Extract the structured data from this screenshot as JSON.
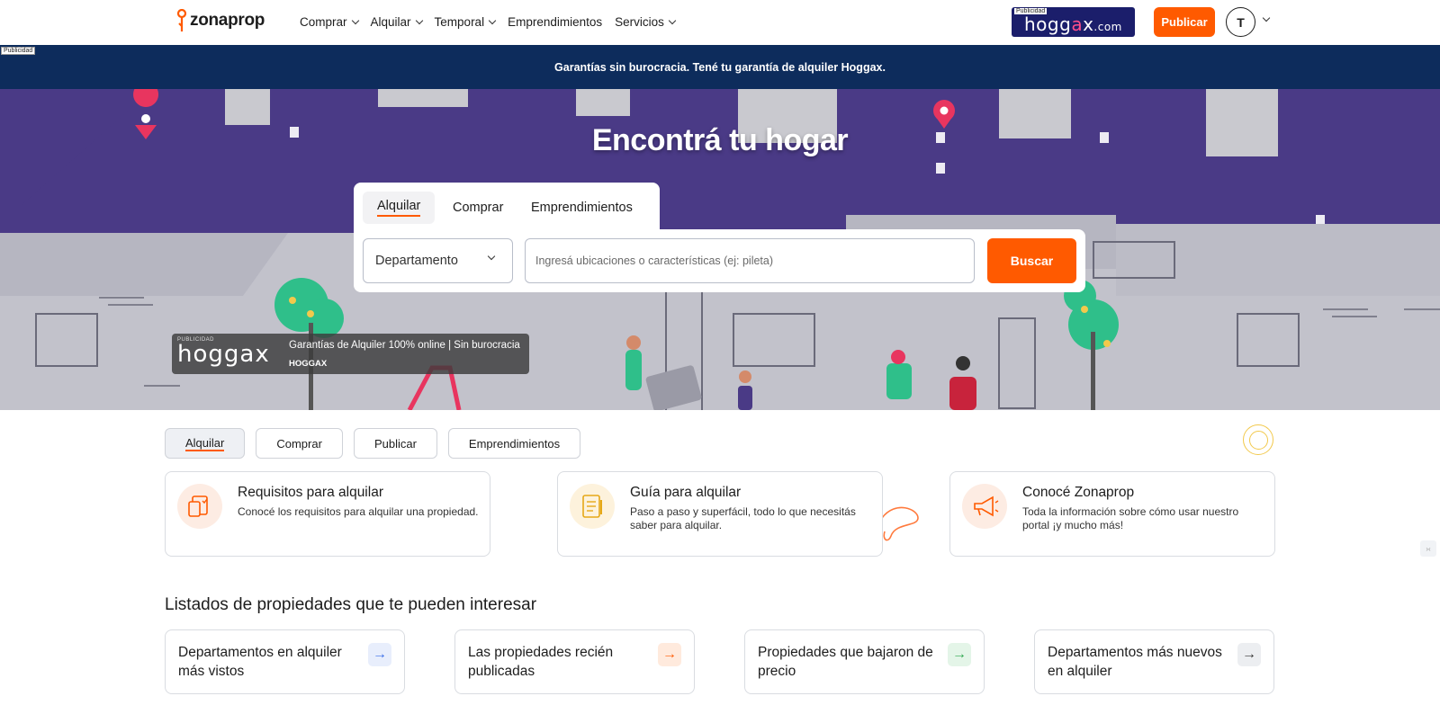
{
  "header": {
    "logo_text": "zonaprop",
    "nav": [
      {
        "label": "Comprar",
        "has_menu": true
      },
      {
        "label": "Alquilar",
        "has_menu": true
      },
      {
        "label": "Temporal",
        "has_menu": true
      },
      {
        "label": "Emprendimientos",
        "has_menu": false
      },
      {
        "label": "Servicios",
        "has_menu": true
      }
    ],
    "ad": {
      "tag": "Publicidad",
      "brand_main": "hogg",
      "brand_x": "a",
      "brand_end": "x",
      "brand_domain": ".com"
    },
    "publish_label": "Publicar",
    "avatar_initial": "T"
  },
  "banner": {
    "tag": "Publicidad",
    "text": "Garantías sin burocracia.  Tené tu garantía de alquiler Hoggax."
  },
  "hero": {
    "title": "Encontrá tu hogar",
    "tabs": [
      "Alquilar",
      "Comprar",
      "Emprendimientos"
    ],
    "active_tab": "Alquilar",
    "property_type": "Departamento",
    "search_placeholder": "Ingresá ubicaciones o características (ej: pileta)",
    "search_button": "Buscar",
    "ad": {
      "tag": "PUBLICIDAD",
      "brand": "hoggax",
      "title": "Garantías de Alquiler 100% online | Sin burocracia",
      "subtitle": "HOGGAX"
    }
  },
  "chips": [
    "Alquilar",
    "Comprar",
    "Publicar",
    "Emprendimientos"
  ],
  "info_cards": [
    {
      "title": "Requisitos para alquilar",
      "desc": "Conocé los requisitos para alquilar una propiedad.",
      "icon": "documents-icon",
      "icon_bg": "#fdece3"
    },
    {
      "title": "Guía para alquilar",
      "desc": "Paso a paso y superfácil, todo lo que necesitás saber para alquilar.",
      "icon": "checklist-icon",
      "icon_bg": "#fdf2dc"
    },
    {
      "title": "Conocé Zonaprop",
      "desc": "Toda la información sobre cómo usar nuestro portal ¡y mucho más!",
      "icon": "megaphone-icon",
      "icon_bg": "#fdece3"
    }
  ],
  "listings_title": "Listados de propiedades que te pueden interesar",
  "listing_cards": [
    {
      "label": "Departamentos en alquiler más vistos",
      "arrow_color": "#3a6ee8",
      "arrow_bg": "#e8eefc"
    },
    {
      "label": "Las propiedades recién publicadas",
      "arrow_color": "#ff5a00",
      "arrow_bg": "#ffeadd"
    },
    {
      "label": "Propiedades que bajaron de precio",
      "arrow_color": "#2fa84f",
      "arrow_bg": "#e4f5e8"
    },
    {
      "label": "Departamentos más nuevos en alquiler",
      "arrow_color": "#333333",
      "arrow_bg": "#eceef1"
    }
  ],
  "colors": {
    "brand_orange": "#ff5a00",
    "banner_navy": "#0d2c5c",
    "hero_purple": "#4a3a86"
  }
}
